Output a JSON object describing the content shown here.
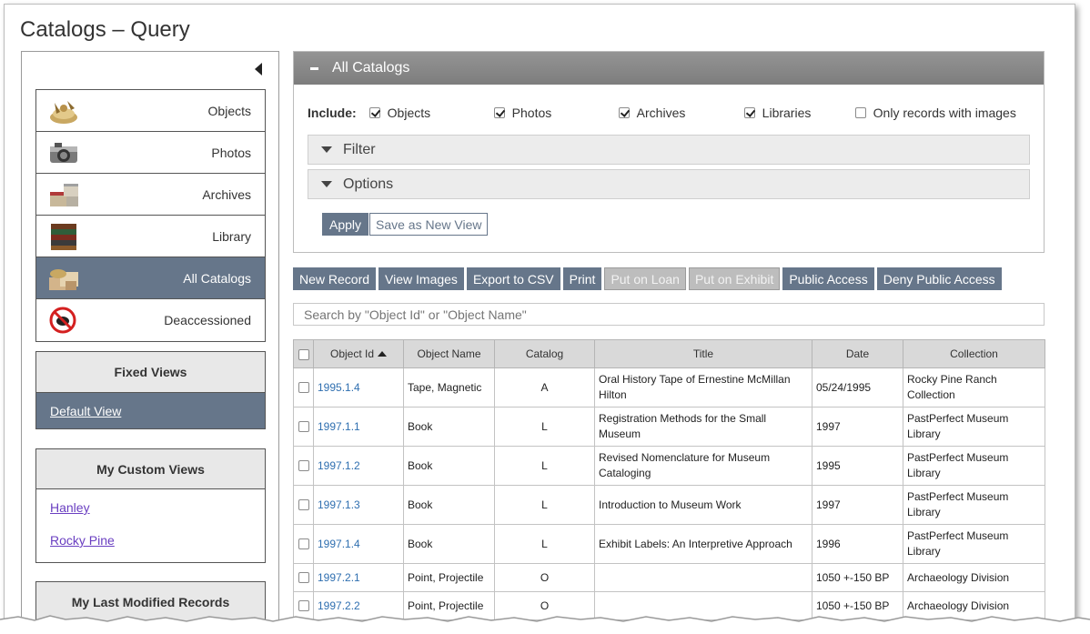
{
  "page": {
    "title": "Catalogs – Query"
  },
  "sidebar": {
    "categories": [
      {
        "label": "Objects",
        "icon": "objects-icon",
        "active": false
      },
      {
        "label": "Photos",
        "icon": "camera-icon",
        "active": false
      },
      {
        "label": "Archives",
        "icon": "archive-boxes-icon",
        "active": false
      },
      {
        "label": "Library",
        "icon": "books-icon",
        "active": false
      },
      {
        "label": "All Catalogs",
        "icon": "all-catalogs-icon",
        "active": true
      },
      {
        "label": "Deaccessioned",
        "icon": "deaccessioned-icon",
        "active": false
      }
    ],
    "fixed_views": {
      "title": "Fixed Views",
      "items": [
        "Default View"
      ]
    },
    "custom_views": {
      "title": "My Custom Views",
      "items": [
        "Hanley",
        "Rocky Pine"
      ]
    },
    "last_modified": {
      "title": "My Last Modified Records"
    }
  },
  "panel": {
    "title": "All Catalogs",
    "include_label": "Include:",
    "include_options": [
      {
        "label": "Objects",
        "checked": true
      },
      {
        "label": "Photos",
        "checked": true
      },
      {
        "label": "Archives",
        "checked": true
      },
      {
        "label": "Libraries",
        "checked": true
      },
      {
        "label": "Only records with images",
        "checked": false
      }
    ],
    "filter_label": "Filter",
    "options_label": "Options",
    "apply_label": "Apply",
    "save_view_label": "Save as New View"
  },
  "toolbar": [
    {
      "label": "New Record",
      "enabled": true
    },
    {
      "label": "View Images",
      "enabled": true
    },
    {
      "label": "Export to CSV",
      "enabled": true
    },
    {
      "label": "Print",
      "enabled": true
    },
    {
      "label": "Put on Loan",
      "enabled": false
    },
    {
      "label": "Put on Exhibit",
      "enabled": false
    },
    {
      "label": "Public Access",
      "enabled": true
    },
    {
      "label": "Deny Public Access",
      "enabled": true
    }
  ],
  "search": {
    "placeholder": "Search by \"Object Id\" or \"Object Name\""
  },
  "table": {
    "columns": [
      "Object Id",
      "Object Name",
      "Catalog",
      "Title",
      "Date",
      "Collection"
    ],
    "sorted_by": "Object Id",
    "rows": [
      [
        "1995.1.4",
        "Tape, Magnetic",
        "A",
        "Oral History Tape of Ernestine McMillan Hilton",
        "05/24/1995",
        "Rocky Pine Ranch Collection"
      ],
      [
        "1997.1.1",
        "Book",
        "L",
        "Registration Methods for the Small Museum",
        "1997",
        "PastPerfect Museum Library"
      ],
      [
        "1997.1.2",
        "Book",
        "L",
        "Revised Nomenclature for Museum Cataloging",
        "1995",
        "PastPerfect Museum Library"
      ],
      [
        "1997.1.3",
        "Book",
        "L",
        "Introduction to Museum Work",
        "1997",
        "PastPerfect Museum Library"
      ],
      [
        "1997.1.4",
        "Book",
        "L",
        "Exhibit Labels: An Interpretive Approach",
        "1996",
        "PastPerfect Museum Library"
      ],
      [
        "1997.2.1",
        "Point, Projectile",
        "O",
        "",
        "1050 +-150 BP",
        "Archaeology Division"
      ],
      [
        "1997.2.2",
        "Point, Projectile",
        "O",
        "",
        "1050 +-150 BP",
        "Archaeology Division"
      ]
    ]
  },
  "colors": {
    "accent": "#66768a",
    "header_bar": "#8a8a8a",
    "link": "#2f6fb0",
    "visited_link": "#6a3fc1"
  }
}
